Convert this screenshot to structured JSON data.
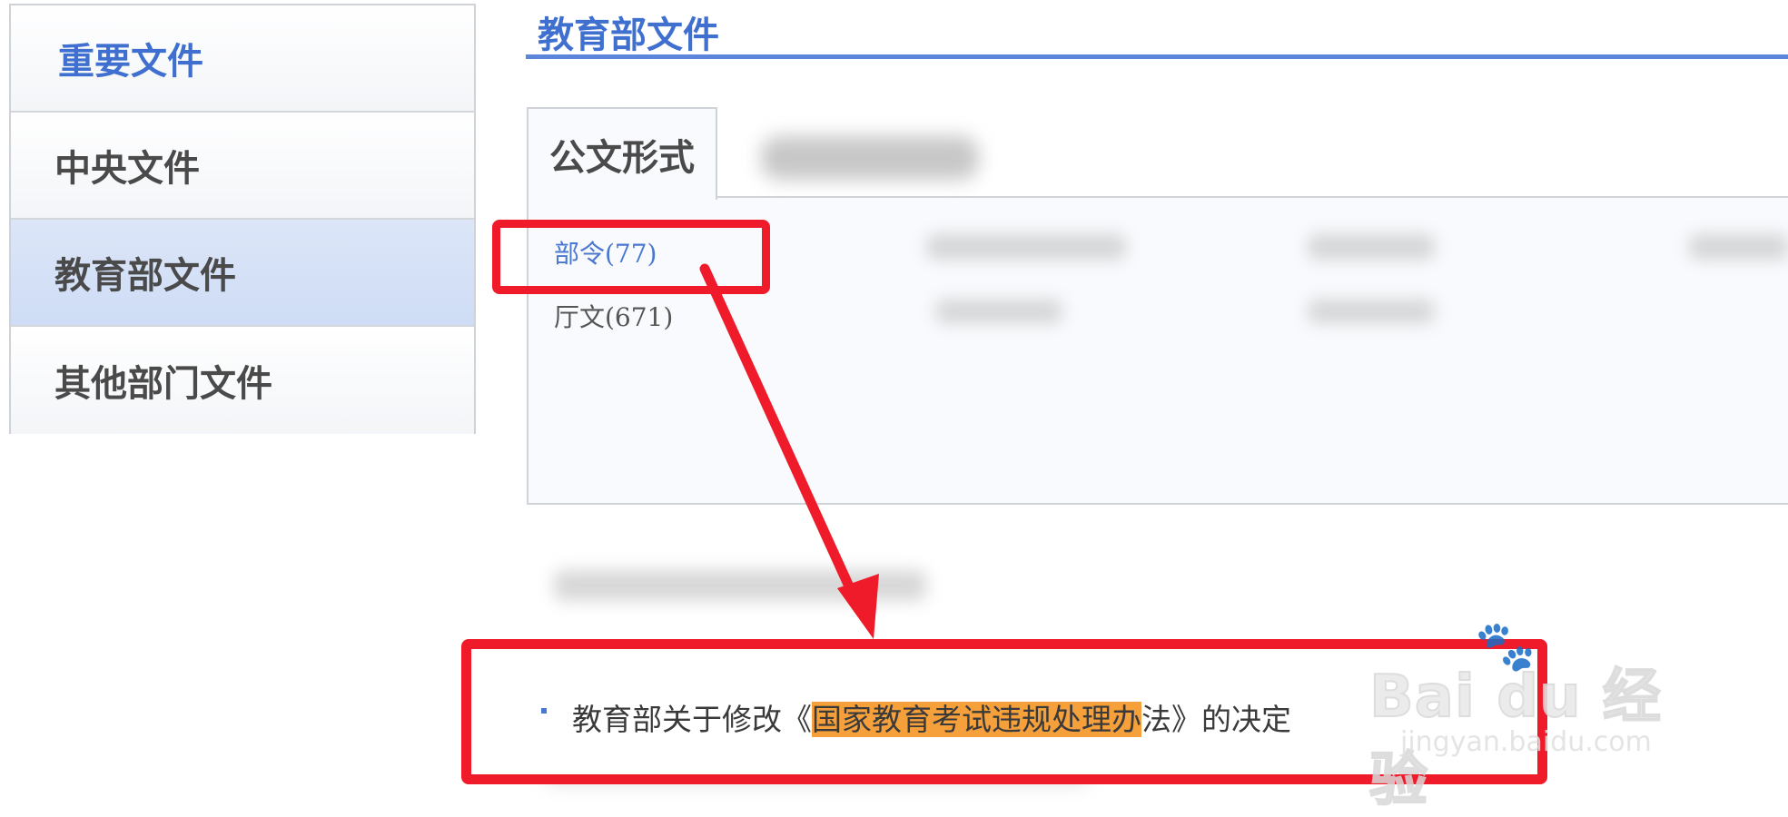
{
  "sidebar": {
    "items": [
      {
        "label": "重要文件"
      },
      {
        "label": "中央文件"
      },
      {
        "label": "教育部文件"
      },
      {
        "label": "其他部门文件"
      }
    ]
  },
  "header": {
    "title": "教育部文件"
  },
  "tabs": {
    "active_label": "公文形式"
  },
  "panel": {
    "links": [
      {
        "label": "部令(77)"
      },
      {
        "label": "厅文(671)"
      }
    ]
  },
  "results": {
    "item_prefix": "教育部关于修改《",
    "item_highlight": "国家教育考试违规处理办",
    "item_suffix": "法》的决定"
  },
  "watermark": {
    "logo": "Bai du 经验",
    "sub": "jingyan.baidu.com"
  },
  "colors": {
    "accent": "#3f6fcf",
    "annotation": "#ef1b2a",
    "highlight": "#f5a03b"
  }
}
